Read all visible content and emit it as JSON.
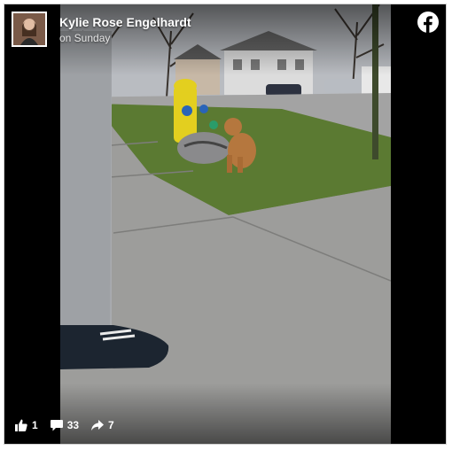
{
  "post": {
    "author_name": "Kylie Rose Engelhardt",
    "timestamp": "on Sunday"
  },
  "stats": {
    "likes": "1",
    "comments": "33",
    "shares": "7"
  },
  "icons": {
    "brand": "facebook-icon",
    "like": "thumbs-up-icon",
    "comment": "comment-icon",
    "share": "share-arrow-icon"
  },
  "colors": {
    "frame": "#000000",
    "text": "#ffffff"
  }
}
